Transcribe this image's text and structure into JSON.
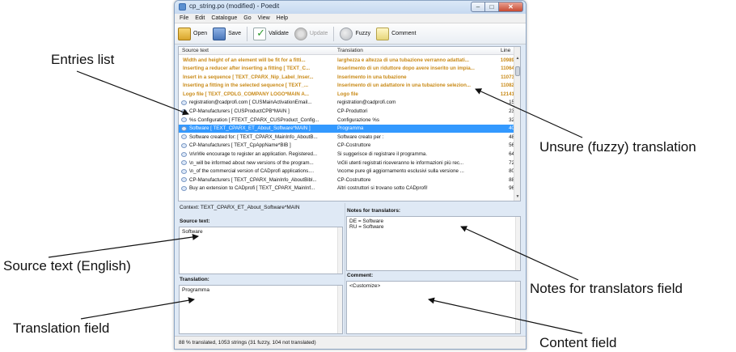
{
  "window": {
    "title": "cp_string.po (modified) - Poedit",
    "controls": {
      "minimize": "–",
      "maximize": "□",
      "close": "✕"
    }
  },
  "menu": [
    "File",
    "Edit",
    "Catalogue",
    "Go",
    "View",
    "Help"
  ],
  "toolbar": {
    "open": "Open",
    "save": "Save",
    "validate": "Validate",
    "update": "Update",
    "fuzzy": "Fuzzy",
    "comment": "Comment"
  },
  "list": {
    "headers": {
      "source": "Source text",
      "translation": "Translation",
      "line": "Line"
    },
    "rows": [
      {
        "source": "Width and height of an element will be fit for a fitti...",
        "translation": "larghezza e altezza di una tubazione verranno adattati...",
        "line": "10989",
        "status": "fuzzy"
      },
      {
        "source": "Inserting a reducer after inserting a fitting [ TEXT_C...",
        "translation": "Inserimento di un riduttore dopo avere inserito un impia...",
        "line": "11064",
        "status": "fuzzy"
      },
      {
        "source": "Insert in a sequence [ TEXT_CPARX_Nip_Label_Inser...",
        "translation": "Inserimento in una tubazione",
        "line": "11073",
        "status": "fuzzy"
      },
      {
        "source": "Inserting a fitting in the selected sequence [ TEXT_...",
        "translation": "Inserimento di un adattatore in una tubazione selezion...",
        "line": "11082",
        "status": "fuzzy"
      },
      {
        "source": "Logo file [ TEXT_CPDLG_COMPANY LOGO*MAIN A...",
        "translation": "Logo file",
        "line": "12141",
        "status": "fuzzy"
      },
      {
        "source": "registration@cadprofi.com [ CUSMainActivationEmail...",
        "translation": "registration@cadprofi.com",
        "line": "15",
        "status": "normal"
      },
      {
        "source": "CP-Manufacturers [ CUSProductCPB*MAIN ]",
        "translation": "CP-Produttori",
        "line": "23",
        "status": "normal"
      },
      {
        "source": "%s Configuration [ FTEXT_CPARX_CUSProduct_Config...",
        "translation": "Configurazione %s",
        "line": "32",
        "status": "normal"
      },
      {
        "source": "Software [ TEXT_CPARX_ET_About_Software*MAIN ]",
        "translation": "Programma",
        "line": "40",
        "status": "selected"
      },
      {
        "source": "Software created for: [ TEXT_CPARX_MainInfo_AboutB...",
        "translation": "Software creato per :",
        "line": "48",
        "status": "normal"
      },
      {
        "source": "CP-Manufacturers [ TEXT_CpAppName*BIB ]",
        "translation": "CP-Costruttore",
        "line": "56",
        "status": "normal"
      },
      {
        "source": "\\n\\nWe encourage to register an application. Registered...",
        "translation": "Si suggerisce di registrare il programma.",
        "line": "64",
        "status": "normal"
      },
      {
        "source": "\\n_will be informed about new versions of the program...",
        "translation": "\\nGli utenti registrati riceveranno le informazioni più rec...",
        "line": "72",
        "status": "normal"
      },
      {
        "source": "\\n_of the commercial version of CADprofi applications....",
        "translation": "\\ncome pure gli aggiornamento esclusivi sulla versione ...",
        "line": "80",
        "status": "normal"
      },
      {
        "source": "CP-Manufacturers [ TEXT_CPARX_MainInfo_AboutBibl...",
        "translation": "CP-Costruttore",
        "line": "88",
        "status": "normal"
      },
      {
        "source": "Buy an extension to CADprofi [ TEXT_CPARX_MainInf...",
        "translation": "Altri costruttori si trovano sotto CADprofi!",
        "line": "96",
        "status": "normal"
      }
    ]
  },
  "panels": {
    "context": "Context: TEXT_CPARX_ET_About_Software*MAIN",
    "source_label": "Source text:",
    "source_value": "Software",
    "translation_label": "Translation:",
    "translation_value": "Programma",
    "notes_label": "Notes for translators:",
    "notes_lines": [
      "DE = Software",
      "RU = Software"
    ],
    "comment_label": "Comment:",
    "comment_value": "<Customize>"
  },
  "status": "88 % translated, 1053 strings (31 fuzzy, 104 not translated)",
  "annotations": {
    "entries_list": "Entries list",
    "fuzzy": "Unsure (fuzzy) translation",
    "source": "Source text (English)",
    "notes": "Notes for translators field",
    "translation": "Translation field",
    "content": "Content field"
  }
}
